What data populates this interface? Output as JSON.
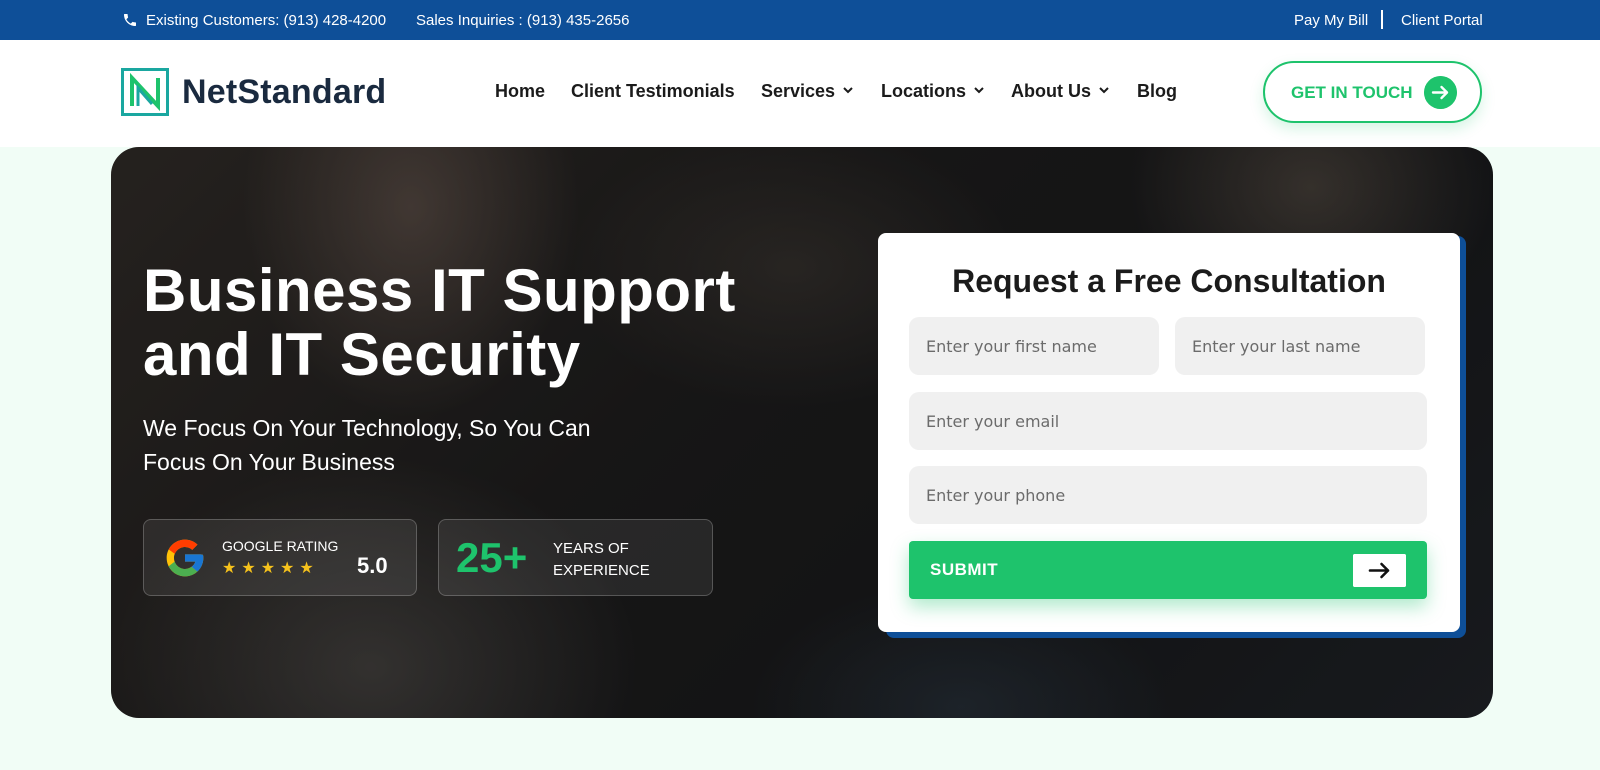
{
  "topbar": {
    "existing_customers": "Existing Customers: (913) 428-4200",
    "sales_inquiries": "Sales Inquiries : (913) 435-2656",
    "pay_bill": "Pay My Bill",
    "client_portal": "Client Portal",
    "icon": "phone-icon"
  },
  "header": {
    "logo_text": "NetStandard",
    "nav": [
      {
        "label": "Home",
        "dropdown": false
      },
      {
        "label": "Client Testimonials",
        "dropdown": false
      },
      {
        "label": "Services",
        "dropdown": true
      },
      {
        "label": "Locations",
        "dropdown": true
      },
      {
        "label": "About Us",
        "dropdown": true
      },
      {
        "label": "Blog",
        "dropdown": false
      }
    ],
    "cta_label": "GET IN TOUCH"
  },
  "hero": {
    "title_line1": "Business IT Support",
    "title_line2": "and IT Security",
    "subtitle_line1": "We Focus On Your Technology, So You Can",
    "subtitle_line2": "Focus On Your Business",
    "rating": {
      "label": "GOOGLE RATING",
      "stars": "★★★★★",
      "value": "5.0"
    },
    "experience": {
      "number": "25+",
      "label_line1": "YEARS OF",
      "label_line2": "EXPERIENCE"
    }
  },
  "form": {
    "title": "Request a Free Consultation",
    "first_name_placeholder": "Enter your first name",
    "last_name_placeholder": "Enter your last name",
    "email_placeholder": "Enter your email",
    "phone_placeholder": "Enter your phone",
    "submit_label": "SUBMIT"
  },
  "colors": {
    "topbar": "#0e4f98",
    "accent_green": "#1ec36c",
    "page_bg": "#f1fdf6",
    "star_gold": "#f6c21c"
  }
}
